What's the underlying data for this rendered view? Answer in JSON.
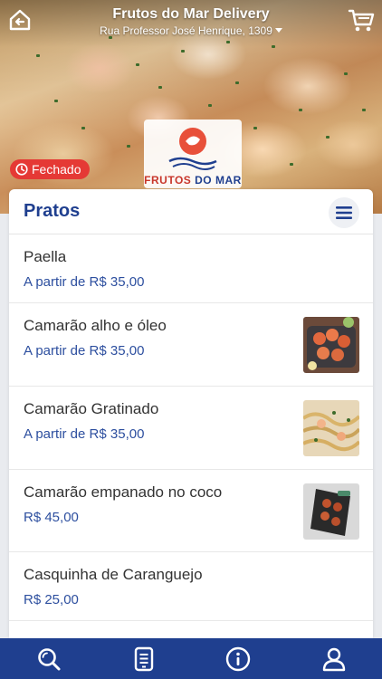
{
  "header": {
    "title": "Frutos do Mar Delivery",
    "address": "Rua Professor José Henrique, 1309",
    "back_icon": "home-back-icon",
    "cart_icon": "cart-icon"
  },
  "hero": {
    "logo_text_1": "FRUTOS",
    "logo_text_2": "DO MAR",
    "status": "Fechado",
    "status_icon": "clock-icon"
  },
  "menu": {
    "section_title": "Pratos",
    "menu_icon": "hamburger-icon",
    "items": [
      {
        "name": "Paella",
        "price": "A partir de R$ 35,00",
        "has_image": false
      },
      {
        "name": "Camarão alho e óleo",
        "price": "A partir de R$ 35,00",
        "has_image": true
      },
      {
        "name": "Camarão Gratinado",
        "price": "A partir de R$ 35,00",
        "has_image": true
      },
      {
        "name": "Camarão empanado no coco",
        "price": "R$ 45,00",
        "has_image": true
      },
      {
        "name": "Casquinha de Caranguejo",
        "price": "R$ 25,00",
        "has_image": false
      }
    ]
  },
  "bottom_nav": {
    "items": [
      "search-icon",
      "receipt-icon",
      "info-icon",
      "user-icon"
    ]
  },
  "colors": {
    "brand_blue": "#1f3f8f",
    "price_blue": "#2d4f9f",
    "status_red": "#e53935"
  }
}
